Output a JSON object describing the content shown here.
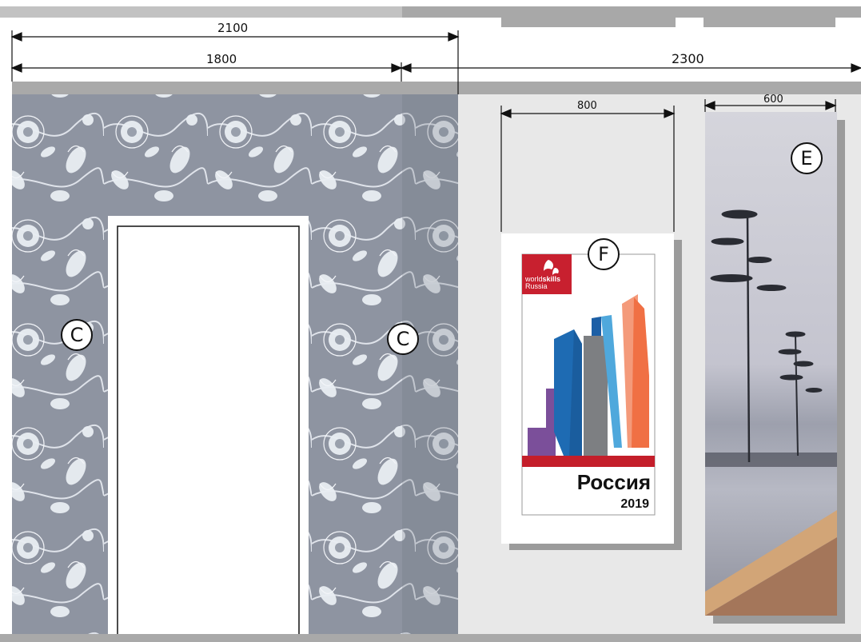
{
  "dimensions": {
    "top_span": "2100",
    "wall_c_span": "1800",
    "right_span": "2300",
    "poster_width": "800",
    "panel_width": "600"
  },
  "labels": {
    "c_left": "C",
    "c_right": "C",
    "f": "F",
    "e": "E"
  },
  "poster": {
    "logo_line1": "world",
    "logo_line1_bold": "skills",
    "logo_line2": "Russia",
    "country": "Россия",
    "year": "2019",
    "colors": {
      "logo_red": "#c8202f",
      "red_band": "#c41e2a",
      "purple": "#7b4f9a",
      "blue": "#1e6bb3",
      "light_blue": "#4fa8dc",
      "gray": "#7d7f82",
      "orange": "#f07044",
      "salmon": "#f49a7a"
    }
  },
  "colors": {
    "wall_pattern_bg": "#8e94a1",
    "floral": "#e7ebf2",
    "wall_light": "#e8e8e8",
    "beam": "#a9a9a9",
    "door": "#ffffff",
    "panel_sky": "#c9c9d2",
    "wood_light": "#d2a577",
    "wood_dark": "#a4765a"
  }
}
